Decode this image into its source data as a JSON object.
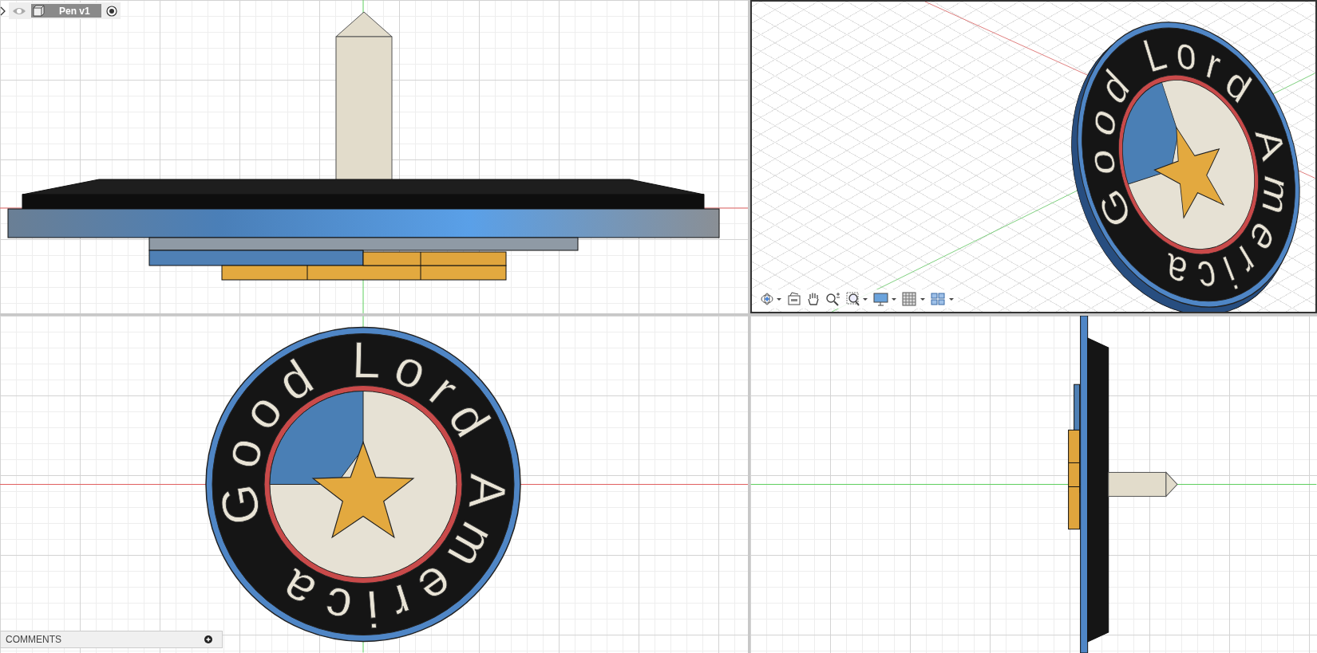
{
  "browser_node": {
    "label": "Pen v1",
    "visible": true
  },
  "views": [
    {
      "kind": "elevation",
      "active": false
    },
    {
      "kind": "iso",
      "active": true,
      "model_label": "Good Lord America"
    },
    {
      "kind": "face",
      "active": false,
      "model_label": "Good Lord America"
    },
    {
      "kind": "side",
      "active": false
    }
  ],
  "comments": {
    "label": "COMMENTS"
  }
}
